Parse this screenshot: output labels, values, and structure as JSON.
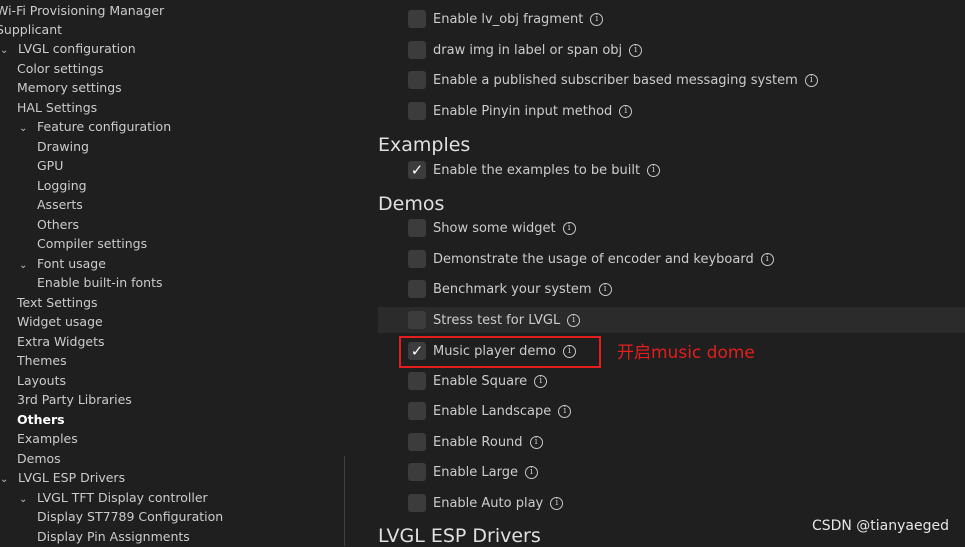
{
  "sidebar": {
    "items": [
      {
        "label": "Wi-Fi Provisioning Manager",
        "level": 0,
        "chevron": false,
        "bold": false
      },
      {
        "label": "Supplicant",
        "level": 0,
        "chevron": false,
        "bold": false
      },
      {
        "label": "LVGL configuration",
        "level": 0,
        "chevron": true,
        "bold": false
      },
      {
        "label": "Color settings",
        "level": 1,
        "chevron": false,
        "bold": false
      },
      {
        "label": "Memory settings",
        "level": 1,
        "chevron": false,
        "bold": false
      },
      {
        "label": "HAL Settings",
        "level": 1,
        "chevron": false,
        "bold": false
      },
      {
        "label": "Feature configuration",
        "level": 1,
        "chevron": true,
        "bold": false
      },
      {
        "label": "Drawing",
        "level": 2,
        "chevron": false,
        "bold": false
      },
      {
        "label": "GPU",
        "level": 2,
        "chevron": false,
        "bold": false
      },
      {
        "label": "Logging",
        "level": 2,
        "chevron": false,
        "bold": false
      },
      {
        "label": "Asserts",
        "level": 2,
        "chevron": false,
        "bold": false
      },
      {
        "label": "Others",
        "level": 2,
        "chevron": false,
        "bold": false
      },
      {
        "label": "Compiler settings",
        "level": 2,
        "chevron": false,
        "bold": false
      },
      {
        "label": "Font usage",
        "level": 1,
        "chevron": true,
        "bold": false
      },
      {
        "label": "Enable built-in fonts",
        "level": 2,
        "chevron": false,
        "bold": false
      },
      {
        "label": "Text Settings",
        "level": 1,
        "chevron": false,
        "bold": false
      },
      {
        "label": "Widget usage",
        "level": 1,
        "chevron": false,
        "bold": false
      },
      {
        "label": "Extra Widgets",
        "level": 1,
        "chevron": false,
        "bold": false
      },
      {
        "label": "Themes",
        "level": 1,
        "chevron": false,
        "bold": false
      },
      {
        "label": "Layouts",
        "level": 1,
        "chevron": false,
        "bold": false
      },
      {
        "label": "3rd Party Libraries",
        "level": 1,
        "chevron": false,
        "bold": false
      },
      {
        "label": "Others",
        "level": 1,
        "chevron": false,
        "bold": true
      },
      {
        "label": "Examples",
        "level": 1,
        "chevron": false,
        "bold": false
      },
      {
        "label": "Demos",
        "level": 1,
        "chevron": false,
        "bold": false
      },
      {
        "label": "LVGL ESP Drivers",
        "level": 0,
        "chevron": true,
        "bold": false
      },
      {
        "label": "LVGL TFT Display controller",
        "level": 1,
        "chevron": true,
        "bold": false
      },
      {
        "label": "Display ST7789 Configuration",
        "level": 2,
        "chevron": false,
        "bold": false
      },
      {
        "label": "Display Pin Assignments",
        "level": 2,
        "chevron": false,
        "bold": false
      }
    ]
  },
  "others_options": [
    {
      "label": "Enable lv_obj fragment",
      "checked": false
    },
    {
      "label": "draw img in label or span obj",
      "checked": false
    },
    {
      "label": "Enable a published subscriber based messaging system",
      "checked": false
    },
    {
      "label": "Enable Pinyin input method",
      "checked": false
    }
  ],
  "examples": {
    "heading": "Examples",
    "options": [
      {
        "label": "Enable the examples to be built",
        "checked": true
      }
    ]
  },
  "demos": {
    "heading": "Demos",
    "options": [
      {
        "label": "Show some widget",
        "checked": false
      },
      {
        "label": "Demonstrate the usage of encoder and keyboard",
        "checked": false
      },
      {
        "label": "Benchmark your system",
        "checked": false
      },
      {
        "label": "Stress test for LVGL",
        "checked": false
      },
      {
        "label": "Music player demo",
        "checked": true
      },
      {
        "label": "Enable Square",
        "checked": false
      },
      {
        "label": "Enable Landscape",
        "checked": false
      },
      {
        "label": "Enable Round",
        "checked": false
      },
      {
        "label": "Enable Large",
        "checked": false
      },
      {
        "label": "Enable Auto play",
        "checked": false
      }
    ]
  },
  "drivers_heading": "LVGL ESP Drivers",
  "annotation": "开启music dome",
  "watermark": "CSDN @tianyaeged",
  "colors": {
    "annotation": "#e51d1d",
    "background": "#1f1f1f",
    "checkbox": "#3c3c3c"
  }
}
